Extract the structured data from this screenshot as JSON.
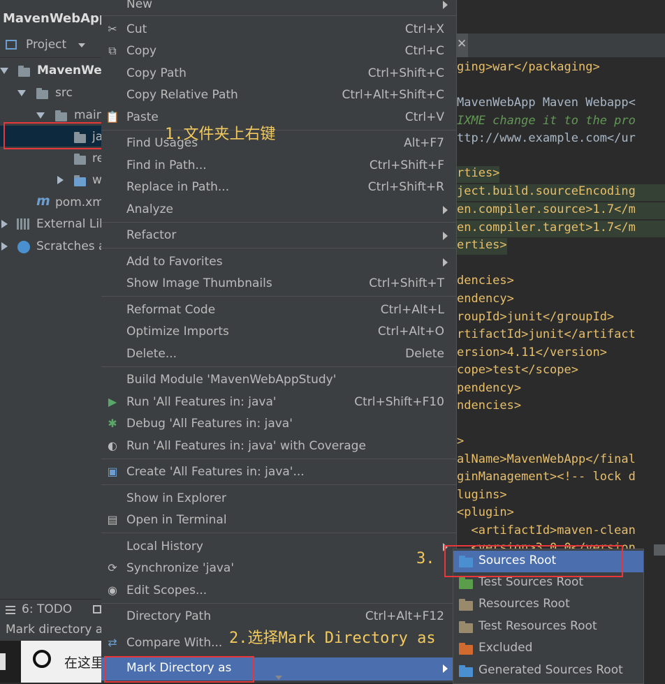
{
  "project_panel": {
    "window_title": "MavenWebApp",
    "tab_label": "Project",
    "tree": [
      {
        "label": "MavenWe",
        "icon": "module-folder-icon"
      },
      {
        "label": "src",
        "icon": "folder-icon"
      },
      {
        "label": "main",
        "icon": "folder-icon"
      },
      {
        "label": "ja",
        "icon": "folder-icon"
      },
      {
        "label": "re",
        "icon": "folder-icon"
      },
      {
        "label": "w",
        "icon": "folder-icon"
      },
      {
        "label": "pom.xml",
        "icon": "maven-icon"
      },
      {
        "label": "External Lib",
        "icon": "library-icon"
      },
      {
        "label": "Scratches a",
        "icon": "scratches-icon"
      }
    ],
    "todo_label": "6: TODO",
    "status_text": "Mark directory a",
    "taskbar_search": "在这里"
  },
  "editor": {
    "lines": [
      "ging>war</packaging>",
      "",
      "MavenWebApp Maven Webapp<",
      "IXME change it to the pro",
      "ttp://www.example.com</ur",
      "",
      "rties>",
      "ject.build.sourceEncoding",
      "en.compiler.source>1.7</m",
      "en.compiler.target>1.7</m",
      "erties>",
      "",
      "dencies>",
      "endency>",
      "roupId>junit</groupId>",
      "rtifactId>junit</artifact",
      "ersion>4.11</version>",
      "cope>test</scope>",
      "pendency>",
      "ndencies>",
      "",
      ">",
      "alName>MavenWebApp</final",
      "ginManagement><!-- lock d",
      "lugins>",
      "<plugin>",
      "  <artifactId>maven-clean",
      "  <version>3.0.0</version"
    ]
  },
  "context_menu": {
    "items": [
      {
        "label": "New",
        "shortcut": "",
        "submenu": true,
        "icon": ""
      },
      {
        "label": "Cut",
        "shortcut": "Ctrl+X",
        "icon": "scissors-icon"
      },
      {
        "label": "Copy",
        "shortcut": "Ctrl+C",
        "icon": "copy-icon"
      },
      {
        "label": "Copy Path",
        "shortcut": "Ctrl+Shift+C"
      },
      {
        "label": "Copy Relative Path",
        "shortcut": "Ctrl+Alt+Shift+C"
      },
      {
        "label": "Paste",
        "shortcut": "Ctrl+V",
        "icon": "clipboard-icon"
      },
      {
        "label": "Find Usages",
        "shortcut": "Alt+F7"
      },
      {
        "label": "Find in Path...",
        "shortcut": "Ctrl+Shift+F"
      },
      {
        "label": "Replace in Path...",
        "shortcut": "Ctrl+Shift+R"
      },
      {
        "label": "Analyze",
        "shortcut": "",
        "submenu": true
      },
      {
        "label": "Refactor",
        "shortcut": "",
        "submenu": true
      },
      {
        "label": "Add to Favorites",
        "shortcut": "",
        "submenu": true
      },
      {
        "label": "Show Image Thumbnails",
        "shortcut": "Ctrl+Shift+T"
      },
      {
        "label": "Reformat Code",
        "shortcut": "Ctrl+Alt+L"
      },
      {
        "label": "Optimize Imports",
        "shortcut": "Ctrl+Alt+O"
      },
      {
        "label": "Delete...",
        "shortcut": "Delete"
      },
      {
        "label": "Build Module 'MavenWebAppStudy'",
        "shortcut": ""
      },
      {
        "label": "Run 'All Features in: java'",
        "shortcut": "Ctrl+Shift+F10",
        "icon": "run-icon"
      },
      {
        "label": "Debug 'All Features in: java'",
        "shortcut": "",
        "icon": "debug-icon"
      },
      {
        "label": "Run 'All Features in: java' with Coverage",
        "shortcut": "",
        "icon": "coverage-icon"
      },
      {
        "label": "Create 'All Features in: java'...",
        "shortcut": "",
        "icon": "create-config-icon"
      },
      {
        "label": "Show in Explorer",
        "shortcut": ""
      },
      {
        "label": "Open in Terminal",
        "shortcut": "",
        "icon": "terminal-icon"
      },
      {
        "label": "Local History",
        "shortcut": "",
        "submenu": true
      },
      {
        "label": "Synchronize 'java'",
        "shortcut": "",
        "icon": "sync-icon"
      },
      {
        "label": "Edit Scopes...",
        "shortcut": "",
        "icon": "scope-icon"
      },
      {
        "label": "Directory Path",
        "shortcut": "Ctrl+Alt+F12"
      },
      {
        "label": "Compare With...",
        "shortcut": "",
        "icon": "compare-icon"
      },
      {
        "label": "Mark Directory as",
        "shortcut": "",
        "submenu": true
      }
    ]
  },
  "submenu": {
    "items": [
      {
        "label": "Sources Root",
        "color": "#4a8fcf"
      },
      {
        "label": "Test Sources Root",
        "color": "#5a9e4b"
      },
      {
        "label": "Resources Root",
        "color": "#9a8a6c"
      },
      {
        "label": "Test Resources Root",
        "color": "#9a8a6c"
      },
      {
        "label": "Excluded",
        "color": "#d06a2e"
      },
      {
        "label": "Generated Sources Root",
        "color": "#4a8fcf"
      }
    ]
  },
  "annotations": {
    "step1": "1.文件夹上右键",
    "step2": "2.选择Mark Directory as",
    "step3": "3."
  },
  "colors": {
    "highlight": "#4b6eaf",
    "annotation": "#f2c95f",
    "red_box": "#e8373b"
  }
}
